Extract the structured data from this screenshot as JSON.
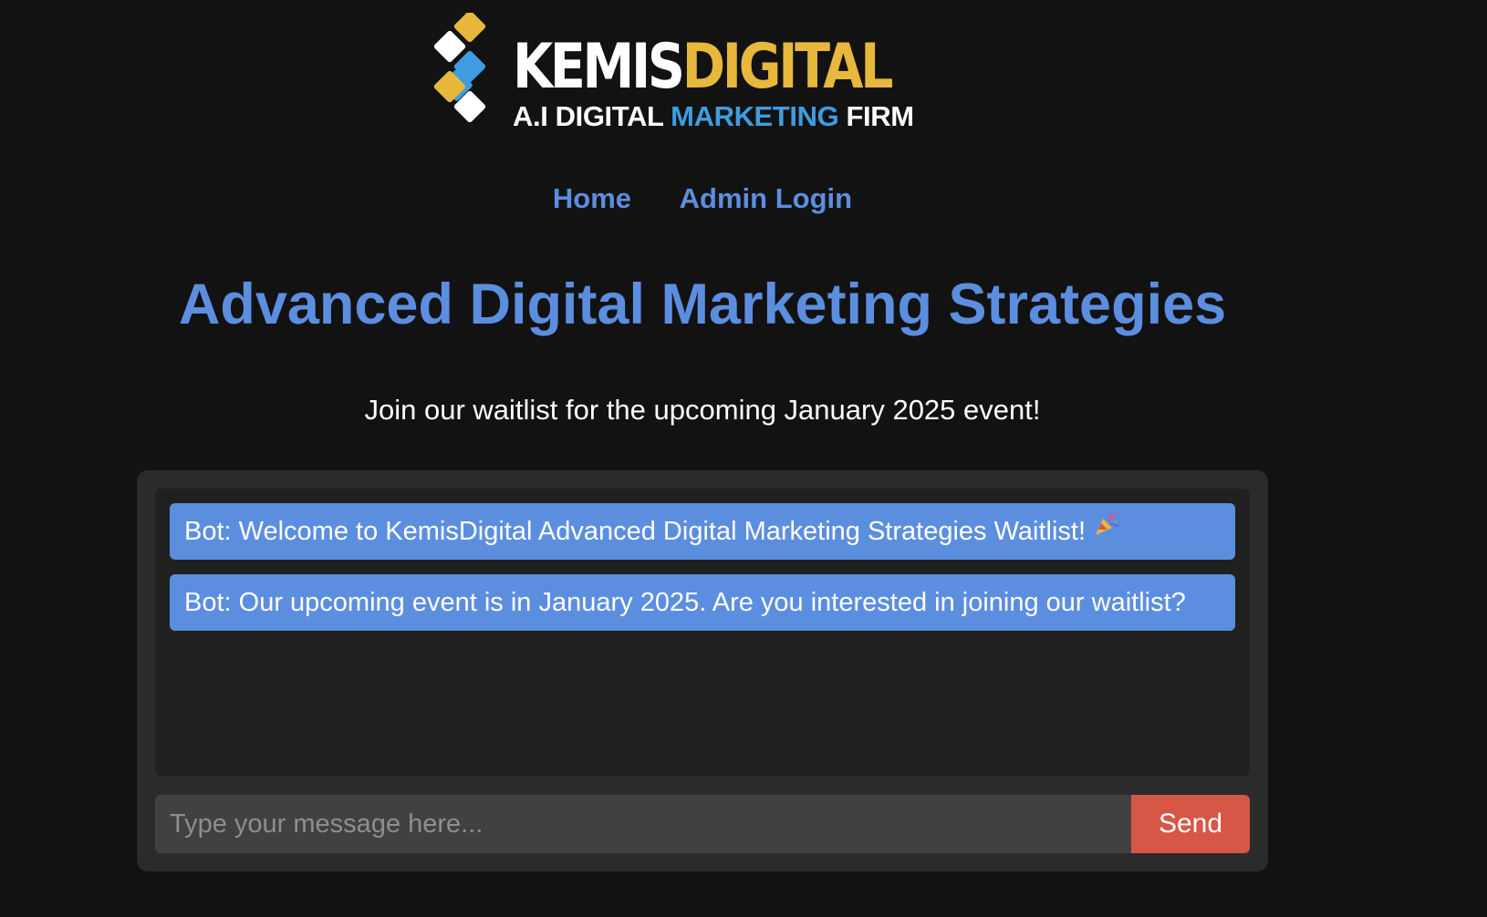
{
  "brand": {
    "word_part1": "KEMIS",
    "word_part2": "DIGITAL",
    "tag_part1": "A.I DIGITAL ",
    "tag_part2": "MARKETING",
    "tag_part3": " FIRM",
    "colors": {
      "white": "#ffffff",
      "gold": "#e8b83c",
      "blue": "#3e9de0"
    }
  },
  "nav": {
    "items": [
      {
        "label": "Home"
      },
      {
        "label": "Admin Login"
      }
    ]
  },
  "hero": {
    "title": "Advanced Digital Marketing Strategies",
    "subtitle": "Join our waitlist for the upcoming January 2025 event!"
  },
  "chat": {
    "messages": [
      {
        "text": "Bot: Welcome to KemisDigital Advanced Digital Marketing Strategies Waitlist!",
        "icon": "party-popper-icon"
      },
      {
        "text": "Bot: Our upcoming event is in January 2025. Are you interested in joining our waitlist?"
      }
    ],
    "input_placeholder": "Type your message here...",
    "input_value": "",
    "send_label": "Send"
  },
  "theme": {
    "background": "#121212",
    "accent": "#5c8ee0",
    "send": "#d85645"
  }
}
